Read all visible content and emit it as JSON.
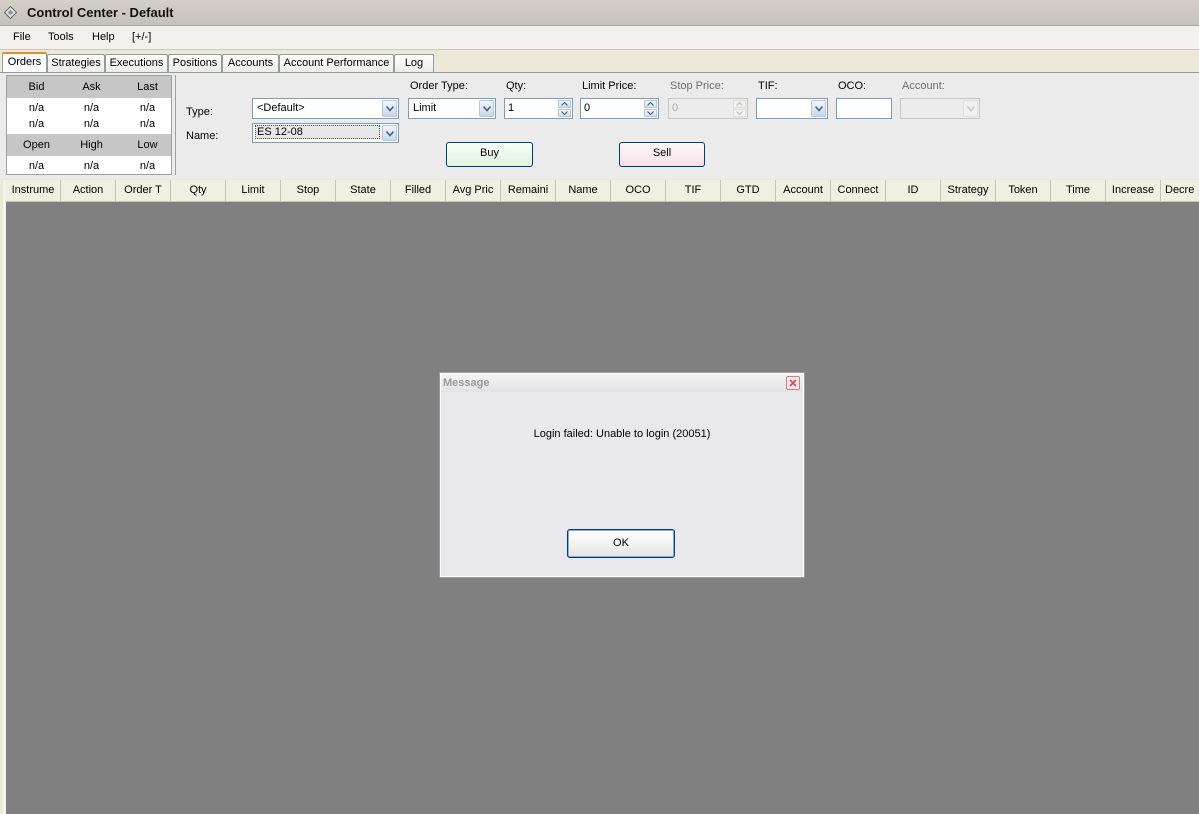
{
  "window": {
    "title": "Control Center - Default"
  },
  "menu": {
    "items": [
      "File",
      "Tools",
      "Help",
      "[+/-]"
    ]
  },
  "tabs": [
    "Orders",
    "Strategies",
    "Executions",
    "Positions",
    "Accounts",
    "Account Performance",
    "Log"
  ],
  "active_tab": "Orders",
  "quotes": {
    "headers1": [
      "Bid",
      "Ask",
      "Last"
    ],
    "row1": [
      "n/a",
      "n/a",
      "n/a"
    ],
    "row2": [
      "n/a",
      "n/a",
      "n/a"
    ],
    "headers2": [
      "Open",
      "High",
      "Low"
    ],
    "row3": [
      "n/a",
      "n/a",
      "n/a"
    ]
  },
  "order_entry": {
    "type_label": "Type:",
    "type_value": "<Default>",
    "name_label": "Name:",
    "name_value": "ES 12-08",
    "order_type_label": "Order Type:",
    "order_type_value": "Limit",
    "qty_label": "Qty:",
    "qty_value": "1",
    "limit_price_label": "Limit Price:",
    "limit_price_value": "0",
    "stop_price_label": "Stop Price:",
    "stop_price_value": "0",
    "tif_label": "TIF:",
    "tif_value": "",
    "oco_label": "OCO:",
    "oco_value": "",
    "account_label": "Account:",
    "account_value": "",
    "buy_label": "Buy",
    "sell_label": "Sell"
  },
  "grid": {
    "columns": [
      "Instrume",
      "Action",
      "Order T",
      "Qty",
      "Limit",
      "Stop",
      "State",
      "Filled",
      "Avg Pric",
      "Remaini",
      "Name",
      "OCO",
      "TIF",
      "GTD",
      "Account",
      "Connect",
      "ID",
      "Strategy",
      "Token",
      "Time",
      "Increase",
      "Decre"
    ]
  },
  "dialog": {
    "title": "Message",
    "message": "Login failed: Unable to login (20051)",
    "ok_label": "OK"
  },
  "colors": {
    "grid_background": "#808080",
    "active_tab_accent": "#e68b2c",
    "buy_button": "#e0f3e0",
    "sell_button": "#f6e2e6"
  }
}
